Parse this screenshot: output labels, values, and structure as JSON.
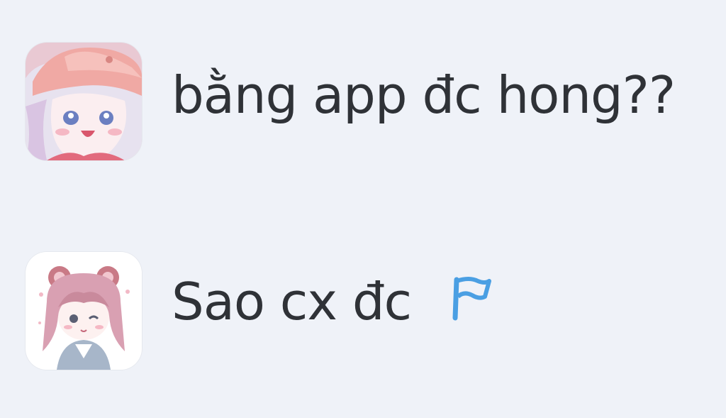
{
  "messages": [
    {
      "avatar_icon": "anime-girl-pink-cap-avatar",
      "text": "bằng app đc hong??"
    },
    {
      "avatar_icon": "anime-girl-bear-ears-avatar",
      "text": "Sao cx đc",
      "flag_icon": "flag-icon",
      "flag_color": "#4a9fe3"
    }
  ]
}
